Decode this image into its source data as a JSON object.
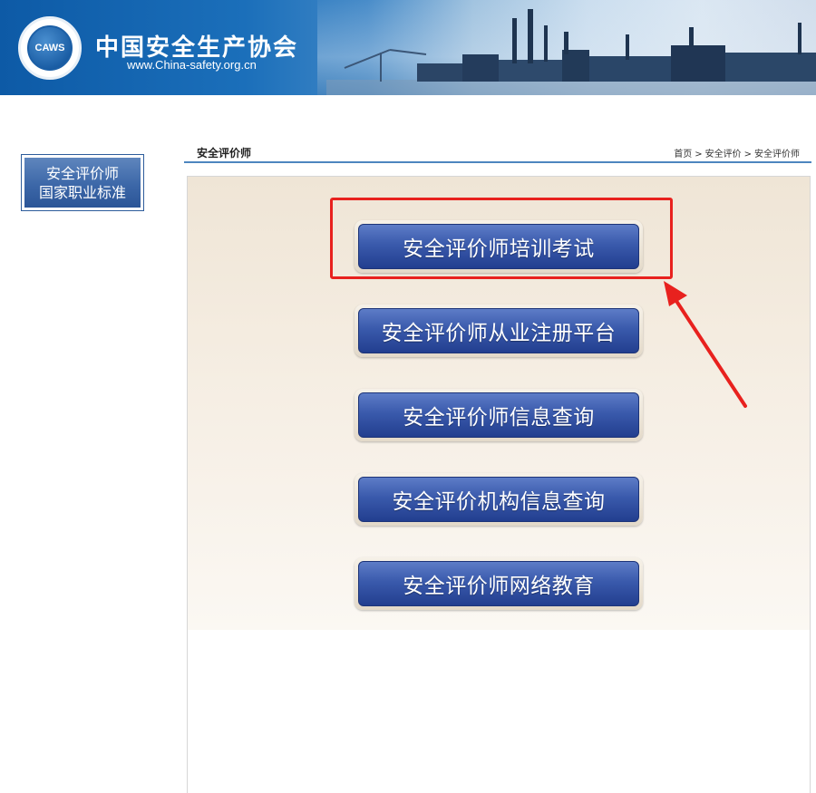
{
  "header": {
    "logo_text": "CAWS",
    "title": "中国安全生产协会",
    "url": "www.China-safety.org.cn"
  },
  "sidebar": {
    "badge_line1": "安全评价师",
    "badge_line2": "国家职业标准"
  },
  "content": {
    "title": "安全评价师",
    "breadcrumb": [
      "首页",
      "安全评价",
      "安全评价师"
    ],
    "breadcrumb_separator": ">"
  },
  "menu": {
    "items": [
      {
        "label": "安全评价师培训考试"
      },
      {
        "label": "安全评价师从业注册平台"
      },
      {
        "label": "安全评价师信息查询"
      },
      {
        "label": "安全评价机构信息查询"
      },
      {
        "label": "安全评价师网络教育"
      }
    ]
  },
  "annotation": {
    "highlight_color": "#e8211e"
  },
  "colors": {
    "brand_blue": "#1b6fba",
    "button_blue": "#3a5aac",
    "panel_cream": "#f4ece0"
  }
}
